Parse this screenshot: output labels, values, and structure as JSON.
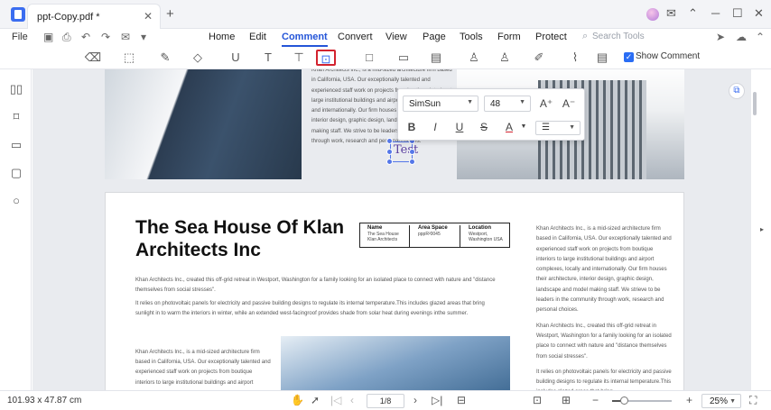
{
  "titlebar": {
    "tab_title": "ppt-Copy.pdf *",
    "close_tab": "✕",
    "new_tab": "+",
    "icons": [
      "mail-icon",
      "chevron-up-icon",
      "minimize-icon",
      "maximize-icon",
      "close-icon"
    ]
  },
  "menubar": {
    "file": "File",
    "tabs": [
      "Home",
      "Edit",
      "Comment",
      "Convert",
      "View",
      "Page",
      "Tools",
      "Form",
      "Protect"
    ],
    "active_tab": "Comment",
    "search_placeholder": "Search Tools"
  },
  "toolbar": {
    "show_comment_label": "Show Comment",
    "show_comment_checked": true,
    "selected_tool": "textbox-tool"
  },
  "text_popup": {
    "font": "SimSun",
    "size": "48",
    "increase_font": "A⁺",
    "decrease_font": "A⁻",
    "bold": "B",
    "italic": "I",
    "underline": "U",
    "strike": "S",
    "font_color": "A",
    "font_color_value": "#d3232f"
  },
  "doc": {
    "top_column_text": "Khan Architects Inc., is a mid-sized architecture firm based in California, USA. Our exceptionally talented and experienced staff work on projects from boutique interiors to large institutional buildings and airport complexes, locally and internationally. Our firm houses their architecture, interior design, graphic design, landscape and model making staff. We strive to be leaders in the community through work, research and personal choices.",
    "inserted_text": "Test",
    "title": "The Sea House Of Klan Architects Inc",
    "info": {
      "name_h": "Name",
      "name_v": "The Sea House Klan Architects",
      "area_h": "Area Space",
      "area_v": "pppR²0045",
      "loc_h": "Location",
      "loc_v": "Westport, Washington USA"
    },
    "para1": "Khan Architects Inc., created this off-grid retreat in Westport, Washington for a family looking for an isolated place to connect with nature and \"distance themselves from social stresses\".",
    "para2": "It relies on photovoltaic panels for electricity and passive building designs to regulate its internal temperature.This includes glazed areas that bring sunlight in to warm the interiors in winter, while an extended west-facingroof provides shade from solar heat during evenings inthe summer.",
    "right1": "Khan Architects Inc., is a mid-sized architecture firm based in California, USA. Our exceptionally talented and experienced staff work on projects from boutique interiors to large institutional buildings and airport complexes, locally and internationally. Our firm houses their architecture, interior design, graphic design, landscape and model making staff. We strieve to be leaders in the community through work, research and personal choices.",
    "right2": "Khan Architects Inc., created this off-grid retreat in Westport, Washington for a family looking for an isolated place to connect with nature and \"distance themselves from social stresses\".",
    "right3": "It relies on photovoltaic panels for electricity and passive building designs to regulate its internal temperature.This includes glazed areas that bring",
    "bottom_left": "Khan Architects Inc., is a mid-sized architecture firm based in California, USA. Our exceptionally talented and experienced staff work on projects from boutique interiors to large institutional buildings and airport"
  },
  "status": {
    "dimensions": "101.93 x 47.87 cm",
    "page": "1/8",
    "zoom": "25%",
    "zoom_level": 0.2
  }
}
